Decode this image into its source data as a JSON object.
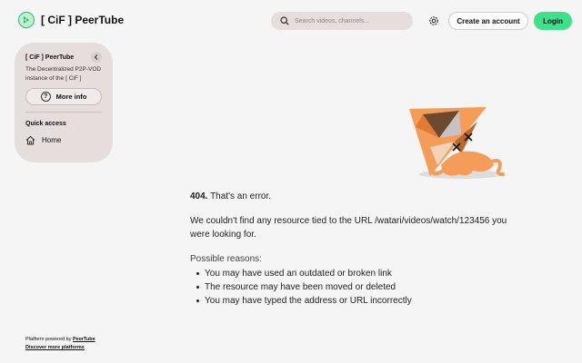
{
  "header": {
    "site_name": "[ CiF ] PeerTube",
    "search_placeholder": "Search videos, channels...",
    "create_account_label": "Create an account",
    "login_label": "Login"
  },
  "sidebar": {
    "title": "[ CiF ] PeerTube",
    "description": "The Decentralized P2P-VOD instance of the [ CiF ]",
    "more_info_label": "More info",
    "quick_access_label": "Quick access",
    "home_label": "Home"
  },
  "error": {
    "code": "404.",
    "code_text": "That's an error.",
    "message": "We couldn't find any resource tied to the URL /watari/videos/watch/123456 you were looking for.",
    "reasons_title": "Possible reasons:",
    "reasons": [
      "You may have used an outdated or broken link",
      "The resource may have been moved or deleted",
      "You may have typed the address or URL incorrectly"
    ]
  },
  "footer": {
    "powered_prefix": "Platform powered by",
    "powered_link": "PeerTube",
    "discover_link": "Discover more platforms"
  },
  "colors": {
    "accent": "#3ee08a",
    "sidebar_bg": "#e6dddd",
    "page_bg": "#f5f5f5"
  },
  "icons": {
    "logo": "peertube-logo-icon",
    "search": "search-icon",
    "settings": "gear-icon",
    "collapse": "chevron-left-icon",
    "more_info": "help-circle-icon",
    "home": "home-icon",
    "illustration": "broken-octopus-illustration"
  }
}
